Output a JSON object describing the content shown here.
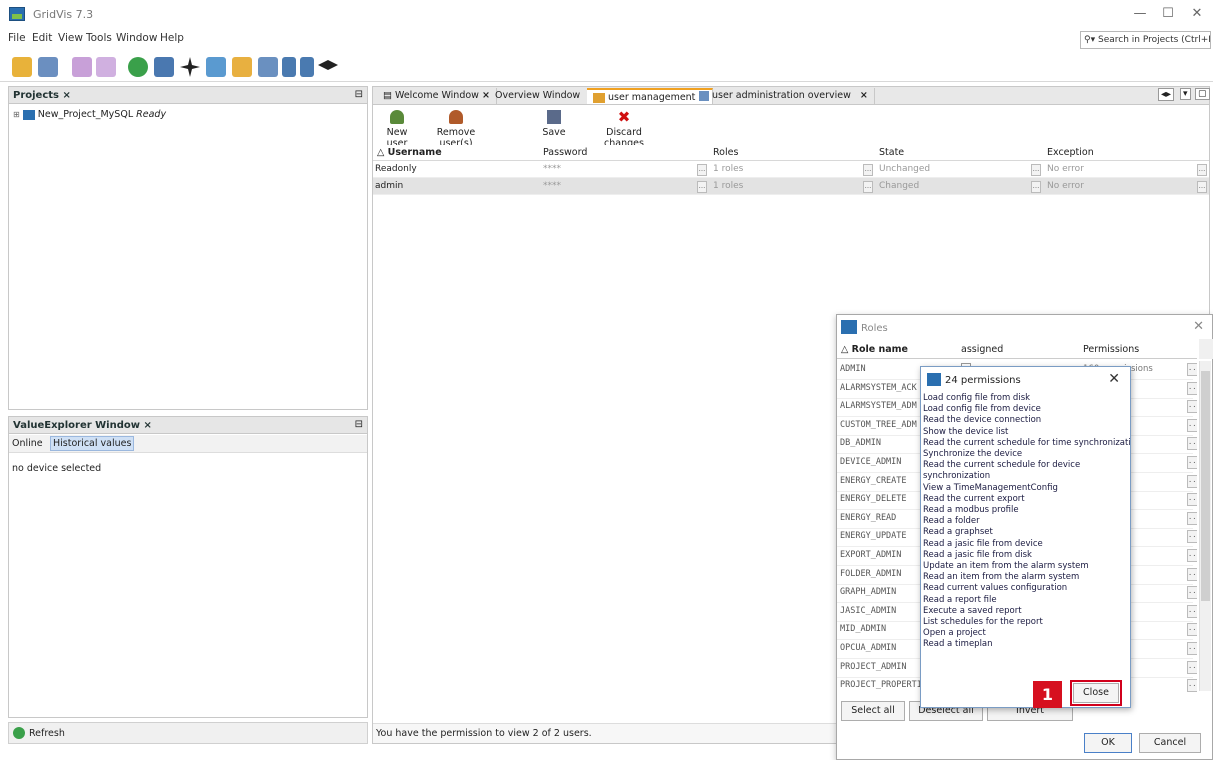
{
  "app": {
    "title": "GridVis 7.3"
  },
  "menu": [
    "File",
    "Edit",
    "View",
    "Tools",
    "Window",
    "Help"
  ],
  "search": {
    "placeholder": "Search in Projects (Ctrl+I)"
  },
  "projects": {
    "tab": "Projects",
    "item_name": "New_Project_MySQL",
    "item_state": "Ready"
  },
  "value_explorer": {
    "tab": "ValueExplorer Window",
    "subtabs": [
      "Online",
      "Historical values"
    ],
    "empty": "no device selected",
    "refresh": "Refresh"
  },
  "editor": {
    "tabs": [
      "Welcome Window",
      "Overview Window",
      "user management",
      "user administration overview"
    ],
    "toolbar": {
      "new_user": "New user",
      "remove_users": "Remove user(s)",
      "save": "Save",
      "discard": "Discard changes"
    },
    "columns": [
      "Username",
      "Password",
      "Roles",
      "State",
      "Exception"
    ],
    "rows": [
      {
        "username": "Readonly",
        "password": "****",
        "roles": "1 roles",
        "state": "Unchanged",
        "exception": "No error"
      },
      {
        "username": "admin",
        "password": "****",
        "roles": "1 roles",
        "state": "Changed",
        "exception": "No error"
      }
    ],
    "status": "You have the permission to view 2 of 2 users."
  },
  "roles_dialog": {
    "title": "Roles",
    "columns": [
      "Role name",
      "assigned",
      "Permissions"
    ],
    "roles": [
      {
        "name": "ADMIN",
        "perm": "160 permissions"
      },
      {
        "name": "ALARMSYSTEM_ACK",
        "perm": "ns"
      },
      {
        "name": "ALARMSYSTEM_ADM",
        "perm": "ns"
      },
      {
        "name": "CUSTOM_TREE_ADM",
        "perm": "ns"
      },
      {
        "name": "DB_ADMIN",
        "perm": "ns"
      },
      {
        "name": "DEVICE_ADMIN",
        "perm": "ns"
      },
      {
        "name": "ENERGY_CREATE",
        "perm": "ns"
      },
      {
        "name": "ENERGY_DELETE",
        "perm": "ns"
      },
      {
        "name": "ENERGY_READ",
        "perm": "ns"
      },
      {
        "name": "ENERGY_UPDATE",
        "perm": "ns"
      },
      {
        "name": "EXPORT_ADMIN",
        "perm": "ns"
      },
      {
        "name": "FOLDER_ADMIN",
        "perm": "ns"
      },
      {
        "name": "GRAPH_ADMIN",
        "perm": "ns"
      },
      {
        "name": "JASIC_ADMIN",
        "perm": "ns"
      },
      {
        "name": "MID_ADMIN",
        "perm": "ns"
      },
      {
        "name": "OPCUA_ADMIN",
        "perm": "ns"
      },
      {
        "name": "PROJECT_ADMIN",
        "perm": "ions"
      },
      {
        "name": "PROJECT_PROPERTI",
        "perm": "ns"
      }
    ],
    "buttons": {
      "select_all": "Select all",
      "deselect_all": "Deselect all",
      "invert": "Invert",
      "ok": "OK",
      "cancel": "Cancel"
    }
  },
  "perm_dialog": {
    "title": "24 permissions",
    "items": [
      "Load config file from disk",
      "Load config file from device",
      "Read the device connection",
      "Show the device list",
      "Read the current schedule for time synchronization",
      "Synchronize the device",
      "Read the current schedule for device",
      "synchronization",
      "View a TimeManagementConfig",
      "Read the current export",
      "Read a modbus profile",
      "Read a folder",
      "Read a graphset",
      "Read a jasic file from device",
      "Read a jasic file from disk",
      "Update an item from the alarm system",
      "Read an item from the alarm system",
      "Read current values configuration",
      "Read a report file",
      "Execute a saved report",
      "List schedules for the report",
      "Open a project",
      "Read a timeplan"
    ],
    "close": "Close"
  },
  "badge": "1",
  "colors": {
    "accent": "#d6101f",
    "tab_active": "#f0a020",
    "link_blue": "#2a6fb0"
  }
}
